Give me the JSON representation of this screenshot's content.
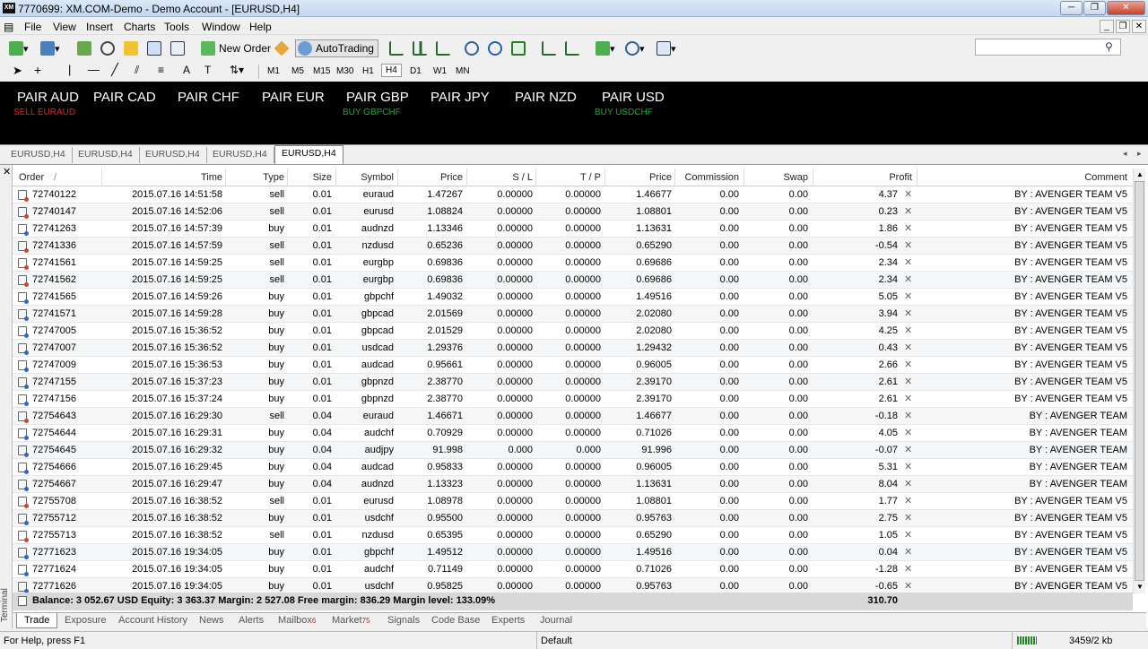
{
  "window": {
    "title": "7770699: XM.COM-Demo - Demo Account - [EURUSD,H4]",
    "logo": "XM"
  },
  "menu": [
    "File",
    "View",
    "Insert",
    "Charts",
    "Tools",
    "Window",
    "Help"
  ],
  "toolbar": {
    "new_order": "New Order",
    "autotrading": "AutoTrading"
  },
  "timeframes": [
    "M1",
    "M5",
    "M15",
    "M30",
    "H1",
    "H4",
    "D1",
    "W1",
    "MN"
  ],
  "active_timeframe": "H4",
  "chart": {
    "pairs": [
      "PAIR AUD",
      "PAIR CAD",
      "PAIR CHF",
      "PAIR EUR",
      "PAIR GBP",
      "PAIR JPY",
      "PAIR NZD",
      "PAIR USD"
    ],
    "signals": [
      {
        "text": "SELL EURAUD",
        "color": "#e0281e"
      },
      {
        "text": "BUY GBPCHF",
        "color": "#1aa83a"
      },
      {
        "text": "BUY USDCHF",
        "color": "#1aa83a"
      }
    ]
  },
  "chart_tabs": [
    "EURUSD,H4",
    "EURUSD,H4",
    "EURUSD,H4",
    "EURUSD,H4",
    "EURUSD,H4"
  ],
  "table": {
    "headers": [
      "Order",
      "/",
      "Time",
      "Type",
      "Size",
      "Symbol",
      "Price",
      "S / L",
      "T / P",
      "Price",
      "Commission",
      "Swap",
      "Profit",
      "Comment"
    ],
    "rows": [
      [
        "72740122",
        "2015.07.16 14:51:58",
        "sell",
        "0.01",
        "euraud",
        "1.47267",
        "0.00000",
        "0.00000",
        "1.46677",
        "0.00",
        "0.00",
        "4.37",
        "BY : AVENGER TEAM V5"
      ],
      [
        "72740147",
        "2015.07.16 14:52:06",
        "sell",
        "0.01",
        "eurusd",
        "1.08824",
        "0.00000",
        "0.00000",
        "1.08801",
        "0.00",
        "0.00",
        "0.23",
        "BY : AVENGER TEAM V5"
      ],
      [
        "72741263",
        "2015.07.16 14:57:39",
        "buy",
        "0.01",
        "audnzd",
        "1.13346",
        "0.00000",
        "0.00000",
        "1.13631",
        "0.00",
        "0.00",
        "1.86",
        "BY : AVENGER TEAM V5"
      ],
      [
        "72741336",
        "2015.07.16 14:57:59",
        "sell",
        "0.01",
        "nzdusd",
        "0.65236",
        "0.00000",
        "0.00000",
        "0.65290",
        "0.00",
        "0.00",
        "-0.54",
        "BY : AVENGER TEAM V5"
      ],
      [
        "72741561",
        "2015.07.16 14:59:25",
        "sell",
        "0.01",
        "eurgbp",
        "0.69836",
        "0.00000",
        "0.00000",
        "0.69686",
        "0.00",
        "0.00",
        "2.34",
        "BY : AVENGER TEAM V5"
      ],
      [
        "72741562",
        "2015.07.16 14:59:25",
        "sell",
        "0.01",
        "eurgbp",
        "0.69836",
        "0.00000",
        "0.00000",
        "0.69686",
        "0.00",
        "0.00",
        "2.34",
        "BY : AVENGER TEAM V5"
      ],
      [
        "72741565",
        "2015.07.16 14:59:26",
        "buy",
        "0.01",
        "gbpchf",
        "1.49032",
        "0.00000",
        "0.00000",
        "1.49516",
        "0.00",
        "0.00",
        "5.05",
        "BY : AVENGER TEAM V5"
      ],
      [
        "72741571",
        "2015.07.16 14:59:28",
        "buy",
        "0.01",
        "gbpcad",
        "2.01569",
        "0.00000",
        "0.00000",
        "2.02080",
        "0.00",
        "0.00",
        "3.94",
        "BY : AVENGER TEAM V5"
      ],
      [
        "72747005",
        "2015.07.16 15:36:52",
        "buy",
        "0.01",
        "gbpcad",
        "2.01529",
        "0.00000",
        "0.00000",
        "2.02080",
        "0.00",
        "0.00",
        "4.25",
        "BY : AVENGER TEAM V5"
      ],
      [
        "72747007",
        "2015.07.16 15:36:52",
        "buy",
        "0.01",
        "usdcad",
        "1.29376",
        "0.00000",
        "0.00000",
        "1.29432",
        "0.00",
        "0.00",
        "0.43",
        "BY : AVENGER TEAM V5"
      ],
      [
        "72747009",
        "2015.07.16 15:36:53",
        "buy",
        "0.01",
        "audcad",
        "0.95661",
        "0.00000",
        "0.00000",
        "0.96005",
        "0.00",
        "0.00",
        "2.66",
        "BY : AVENGER TEAM V5"
      ],
      [
        "72747155",
        "2015.07.16 15:37:23",
        "buy",
        "0.01",
        "gbpnzd",
        "2.38770",
        "0.00000",
        "0.00000",
        "2.39170",
        "0.00",
        "0.00",
        "2.61",
        "BY : AVENGER TEAM V5"
      ],
      [
        "72747156",
        "2015.07.16 15:37:24",
        "buy",
        "0.01",
        "gbpnzd",
        "2.38770",
        "0.00000",
        "0.00000",
        "2.39170",
        "0.00",
        "0.00",
        "2.61",
        "BY : AVENGER TEAM V5"
      ],
      [
        "72754643",
        "2015.07.16 16:29:30",
        "sell",
        "0.04",
        "euraud",
        "1.46671",
        "0.00000",
        "0.00000",
        "1.46677",
        "0.00",
        "0.00",
        "-0.18",
        "BY : AVENGER TEAM"
      ],
      [
        "72754644",
        "2015.07.16 16:29:31",
        "buy",
        "0.04",
        "audchf",
        "0.70929",
        "0.00000",
        "0.00000",
        "0.71026",
        "0.00",
        "0.00",
        "4.05",
        "BY : AVENGER TEAM"
      ],
      [
        "72754645",
        "2015.07.16 16:29:32",
        "buy",
        "0.04",
        "audjpy",
        "91.998",
        "0.000",
        "0.000",
        "91.996",
        "0.00",
        "0.00",
        "-0.07",
        "BY : AVENGER TEAM"
      ],
      [
        "72754666",
        "2015.07.16 16:29:45",
        "buy",
        "0.04",
        "audcad",
        "0.95833",
        "0.00000",
        "0.00000",
        "0.96005",
        "0.00",
        "0.00",
        "5.31",
        "BY : AVENGER TEAM"
      ],
      [
        "72754667",
        "2015.07.16 16:29:47",
        "buy",
        "0.04",
        "audnzd",
        "1.13323",
        "0.00000",
        "0.00000",
        "1.13631",
        "0.00",
        "0.00",
        "8.04",
        "BY : AVENGER TEAM"
      ],
      [
        "72755708",
        "2015.07.16 16:38:52",
        "sell",
        "0.01",
        "eurusd",
        "1.08978",
        "0.00000",
        "0.00000",
        "1.08801",
        "0.00",
        "0.00",
        "1.77",
        "BY : AVENGER TEAM V5"
      ],
      [
        "72755712",
        "2015.07.16 16:38:52",
        "buy",
        "0.01",
        "usdchf",
        "0.95500",
        "0.00000",
        "0.00000",
        "0.95763",
        "0.00",
        "0.00",
        "2.75",
        "BY : AVENGER TEAM V5"
      ],
      [
        "72755713",
        "2015.07.16 16:38:52",
        "sell",
        "0.01",
        "nzdusd",
        "0.65395",
        "0.00000",
        "0.00000",
        "0.65290",
        "0.00",
        "0.00",
        "1.05",
        "BY : AVENGER TEAM V5"
      ],
      [
        "72771623",
        "2015.07.16 19:34:05",
        "buy",
        "0.01",
        "gbpchf",
        "1.49512",
        "0.00000",
        "0.00000",
        "1.49516",
        "0.00",
        "0.00",
        "0.04",
        "BY : AVENGER TEAM V5"
      ],
      [
        "72771624",
        "2015.07.16 19:34:05",
        "buy",
        "0.01",
        "audchf",
        "0.71149",
        "0.00000",
        "0.00000",
        "0.71026",
        "0.00",
        "0.00",
        "-1.28",
        "BY : AVENGER TEAM V5"
      ],
      [
        "72771626",
        "2015.07.16 19:34:05",
        "buy",
        "0.01",
        "usdchf",
        "0.95825",
        "0.00000",
        "0.00000",
        "0.95763",
        "0.00",
        "0.00",
        "-0.65",
        "BY : AVENGER TEAM V5"
      ]
    ],
    "balance_line": "Balance: 3 052.67 USD  Equity: 3 363.37  Margin: 2 527.08  Free margin: 836.29  Margin level: 133.09%",
    "total_profit": "310.70"
  },
  "terminal_label": "Terminal",
  "bottom_tabs": [
    {
      "label": "Trade",
      "badge": ""
    },
    {
      "label": "Exposure",
      "badge": ""
    },
    {
      "label": "Account History",
      "badge": ""
    },
    {
      "label": "News",
      "badge": ""
    },
    {
      "label": "Alerts",
      "badge": ""
    },
    {
      "label": "Mailbox",
      "badge": "6"
    },
    {
      "label": "Market",
      "badge": "75"
    },
    {
      "label": "Signals",
      "badge": ""
    },
    {
      "label": "Code Base",
      "badge": ""
    },
    {
      "label": "Experts",
      "badge": ""
    },
    {
      "label": "Journal",
      "badge": ""
    }
  ],
  "status": {
    "help": "For Help, press F1",
    "profile": "Default",
    "traffic": "3459/2 kb"
  }
}
